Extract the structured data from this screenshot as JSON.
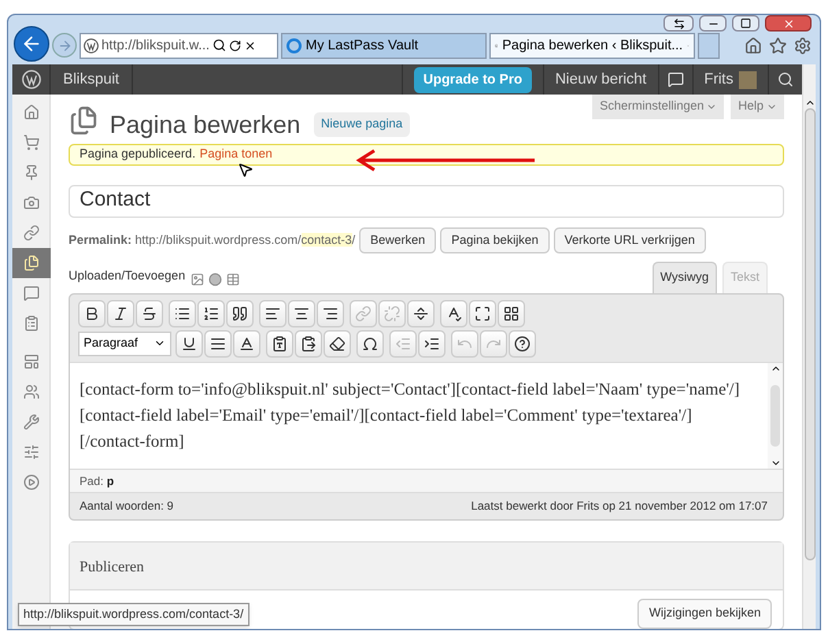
{
  "browser": {
    "address": "http://blikspuit.w...",
    "tabs": [
      {
        "title": "My LastPass Vault",
        "kind": "ie",
        "selected": false
      },
      {
        "title": "Pagina bewerken ‹ Blikspuit...",
        "kind": "wp",
        "selected": true
      }
    ],
    "status_url": "http://blikspuit.wordpress.com/contact-3/"
  },
  "admin_bar": {
    "site": "Blikspuit",
    "upgrade": "Upgrade to Pro",
    "new_post": "Nieuw bericht",
    "user": "Frits"
  },
  "sidebar": {
    "items": [
      {
        "kind": "home",
        "selected": false
      },
      {
        "kind": "cart",
        "selected": false
      },
      {
        "kind": "pin",
        "selected": false
      },
      {
        "kind": "media",
        "selected": false
      },
      {
        "kind": "link",
        "selected": false
      },
      {
        "kind": "pages",
        "selected": true
      },
      {
        "kind": "comments",
        "selected": false
      },
      {
        "kind": "form",
        "selected": false
      },
      {
        "kind": "appearance",
        "selected": false
      },
      {
        "kind": "users",
        "selected": false
      },
      {
        "kind": "tools",
        "selected": false
      },
      {
        "kind": "settings",
        "selected": false
      },
      {
        "kind": "collapse",
        "selected": false
      }
    ]
  },
  "screen_options": [
    "Scherminstellingen",
    "Help"
  ],
  "header": {
    "title": "Pagina bewerken",
    "add_new": "Nieuwe pagina"
  },
  "notice": {
    "text": "Pagina gepubliceerd.",
    "link": "Pagina tonen"
  },
  "post_title": "Contact",
  "permalink": {
    "label": "Permalink:",
    "base": "http://blikspuit.wordpress.com/",
    "slug": "contact-3",
    "end": "/",
    "buttons": [
      "Bewerken",
      "Pagina bekijken",
      "Verkorte URL verkrijgen"
    ]
  },
  "media": {
    "label": "Uploaden/Toevoegen"
  },
  "editor_tabs": [
    {
      "label": "Wysiwyg",
      "selected": true
    },
    {
      "label": "Tekst",
      "selected": false
    }
  ],
  "toolbar_row_1": [
    {
      "kind": "bold",
      "disabled": false
    },
    {
      "kind": "italic",
      "disabled": false
    },
    {
      "kind": "strike",
      "disabled": false
    },
    {
      "kind": "bullets",
      "disabled": false
    },
    {
      "kind": "numbers",
      "disabled": false
    },
    {
      "kind": "quote",
      "disabled": false
    },
    {
      "kind": "left",
      "disabled": false
    },
    {
      "kind": "center",
      "disabled": false
    },
    {
      "kind": "right",
      "disabled": false
    },
    {
      "kind": "link",
      "disabled": true
    },
    {
      "kind": "unlink",
      "disabled": true
    },
    {
      "kind": "more",
      "disabled": false
    },
    {
      "kind": "spell",
      "disabled": false
    },
    {
      "kind": "fullscreen",
      "disabled": false
    },
    {
      "kind": "kitchen",
      "disabled": false
    }
  ],
  "format": "Paragraaf",
  "toolbar_row_2": [
    {
      "kind": "underline",
      "disabled": false
    },
    {
      "kind": "justify",
      "disabled": false
    },
    {
      "kind": "color",
      "disabled": false
    },
    {
      "kind": "pastetext",
      "disabled": false
    },
    {
      "kind": "pasteword",
      "disabled": false
    },
    {
      "kind": "eraser",
      "disabled": false
    },
    {
      "kind": "omega",
      "disabled": false
    },
    {
      "kind": "outdent",
      "disabled": true
    },
    {
      "kind": "indent",
      "disabled": false
    },
    {
      "kind": "undo",
      "disabled": true
    },
    {
      "kind": "redo",
      "disabled": true
    },
    {
      "kind": "help",
      "disabled": false
    }
  ],
  "content": "[contact-form to='info@blikspuit.nl' subject='Contact'][contact-field label='Naam' type='name'/][contact-field label='Email' type='email'/][contact-field label='Comment' type='textarea'/][/contact-form]",
  "path": {
    "label": "Pad:",
    "value": "p"
  },
  "word_count": "Aantal woorden: 9",
  "last_edited": "Laatst bewerkt door Frits op 21 november 2012 om 17:07",
  "publish": {
    "title": "Publiceren",
    "button": "Wijzigingen bekijken"
  }
}
